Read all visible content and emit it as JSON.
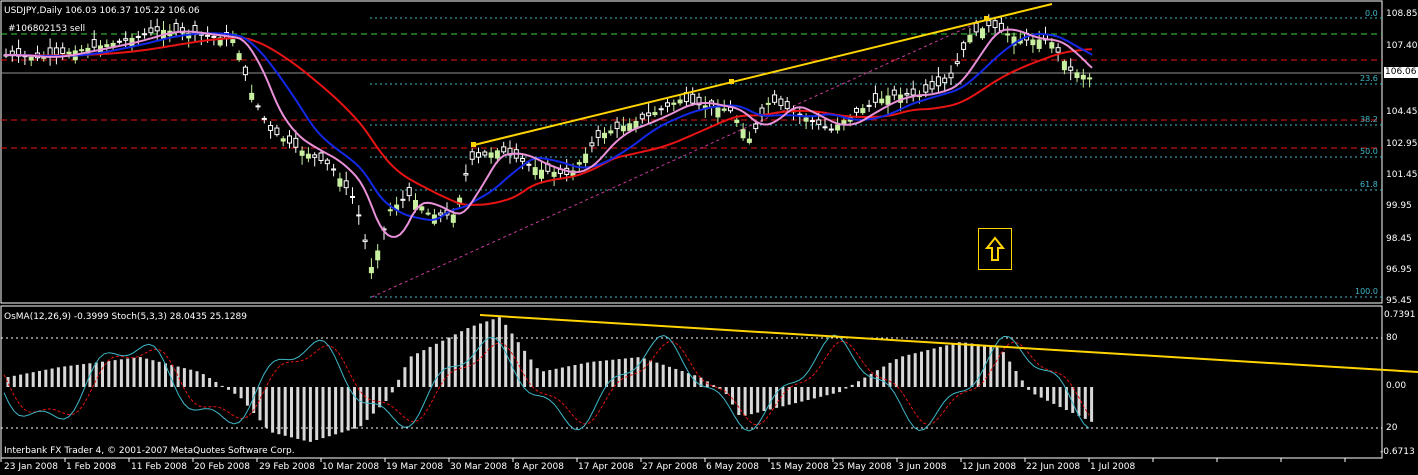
{
  "chart_header": {
    "symbol_line": "USDJPY,Daily  106.03 106.37 105.22 106.06",
    "order_label": "#106802153 sell"
  },
  "osc_header": "OsMA(12,26,9) -0.3999  Stoch(5,3,3) 28.0435 25.1289",
  "copyright": "Interbank FX Trader 4, © 2001-2007 MetaQuotes Software Corp.",
  "current_price": "106.06",
  "price_axis": [
    "108.85",
    "107.40",
    "106.06",
    "104.45",
    "102.95",
    "101.45",
    "99.95",
    "98.45",
    "96.95",
    "95.45"
  ],
  "osc_axis": [
    "0.7391",
    "80",
    "0.00",
    "20",
    "-0.6713"
  ],
  "fib_levels": [
    "0.0",
    "23.6",
    "38.2",
    "50.0",
    "61.8",
    "100.0"
  ],
  "date_axis": [
    "23 Jan 2008",
    "1 Feb 2008",
    "11 Feb 2008",
    "20 Feb 2008",
    "29 Feb 2008",
    "10 Mar 2008",
    "19 Mar 2008",
    "30 Mar 2008",
    "8 Apr 2008",
    "17 Apr 2008",
    "27 Apr 2008",
    "6 May 2008",
    "15 May 2008",
    "25 May 2008",
    "3 Jun 2008",
    "12 Jun 2008",
    "22 Jun 2008",
    "1 Jul 2008"
  ],
  "signal_icon": "up-arrow-icon",
  "colors": {
    "background": "#000000",
    "bull_candle": "#c8f0a0",
    "ma_slow": "#e81414",
    "ma_mid": "#1428e8",
    "ma_fast": "#e890d8",
    "trendline": "#ffd400",
    "fib_line": "#3fb8c8",
    "histogram": "#d8d8d8",
    "stoch_main": "#3fb8c8",
    "stoch_signal": "#e81414"
  }
}
